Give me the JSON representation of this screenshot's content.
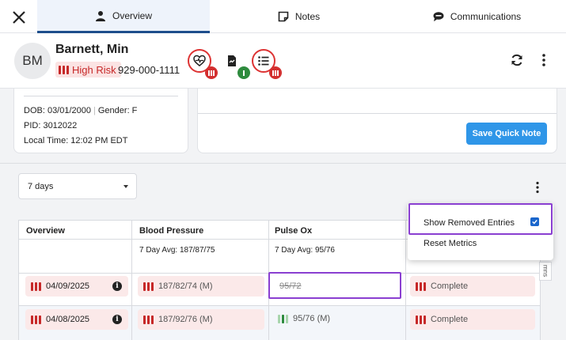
{
  "tabs": [
    {
      "label": "Overview",
      "icon": "user-icon"
    },
    {
      "label": "Notes",
      "icon": "note-icon"
    },
    {
      "label": "Communications",
      "icon": "chat-icon"
    }
  ],
  "patient": {
    "initials": "BM",
    "name": "Barnett, Min",
    "risk": "High Risk",
    "phone": "929-000-1111",
    "dob": "DOB: 03/01/2000",
    "gender": "Gender: F",
    "pid": "PID: 3012022",
    "local_time": "Local Time: 12:02 PM EDT"
  },
  "quick_note": {
    "save_label": "Save Quick Note"
  },
  "filters": {
    "range": "7 days"
  },
  "table": {
    "headers": [
      "Overview",
      "Blood Pressure",
      "Pulse Ox"
    ],
    "averages": {
      "bp": "7 Day Avg: 187/87/75",
      "pulse": "7 Day Avg: 95/76"
    },
    "rows": [
      {
        "date": "04/09/2025",
        "bp": "187/82/74 (M)",
        "pulse": "95/72",
        "pulse_removed": true,
        "status": "Complete"
      },
      {
        "date": "04/08/2025",
        "bp": "187/92/76 (M)",
        "pulse": "95/76 (M)",
        "pulse_removed": false,
        "status": "Complete"
      }
    ],
    "columns_tab": "mns"
  },
  "menu": {
    "show_removed": "Show Removed Entries",
    "show_removed_checked": true,
    "reset": "Reset Metrics"
  },
  "colors": {
    "primary": "#2f96e8",
    "risk": "#c62828",
    "highlight": "#8a3fd1",
    "active_tab": "#1e4e8c"
  }
}
